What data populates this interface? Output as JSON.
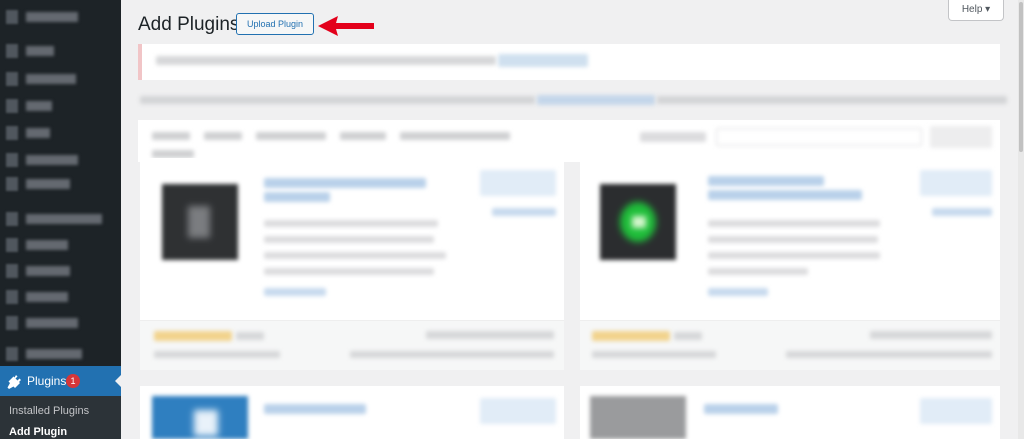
{
  "header": {
    "title": "Add Plugins",
    "upload_label": "Upload Plugin",
    "help_label": "Help ▾"
  },
  "sidebar": {
    "plugins_label": "Plugins",
    "plugins_badge": "1",
    "submenu": [
      {
        "label": "Installed Plugins"
      },
      {
        "label": "Add Plugin"
      }
    ]
  },
  "colors": {
    "sidebar_bg": "#1d2327",
    "accent": "#2271b1",
    "badge": "#d63638",
    "annotation_arrow": "#e3001b"
  },
  "icons": {
    "plugins": "plug-icon",
    "help_caret": "chevron-down-icon",
    "annotation": "red-arrow"
  }
}
